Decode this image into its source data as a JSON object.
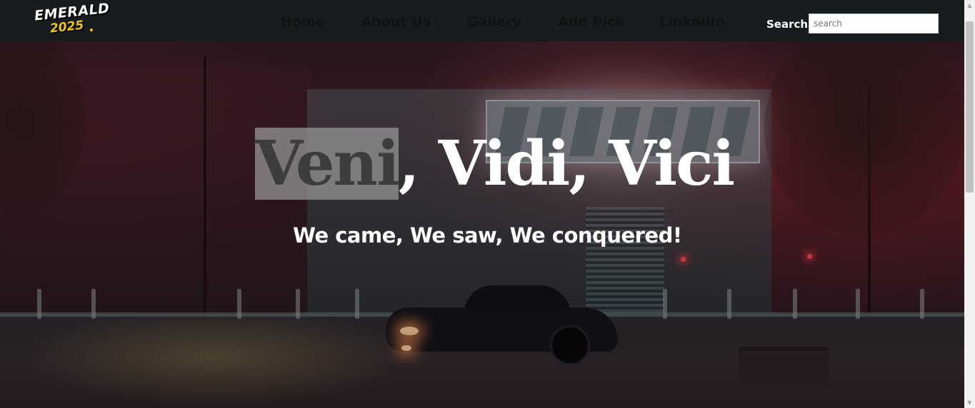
{
  "brand": {
    "logo_line1": "EMERALD",
    "logo_line2": "2025",
    "logo_color": "#f2c21a"
  },
  "nav": {
    "items": [
      {
        "label": "Home"
      },
      {
        "label": "About Us"
      },
      {
        "label": "Gallery"
      },
      {
        "label": "Add Pics"
      },
      {
        "label": "LinkedIn"
      }
    ]
  },
  "search": {
    "label": "Search",
    "placeholder": "search",
    "value": ""
  },
  "hero": {
    "title_selected": "Veni",
    "title_rest": ", Vidi, Vici",
    "subtitle": "We came, We saw, We conquered!"
  },
  "icons": {
    "scroll_up": "chevron-up-icon",
    "scroll_down": "chevron-down-icon"
  },
  "colors": {
    "navbar_bg": "#171c1f",
    "nav_text": "#111111",
    "hero_text": "#ffffff",
    "selection_bg": "#969696"
  }
}
